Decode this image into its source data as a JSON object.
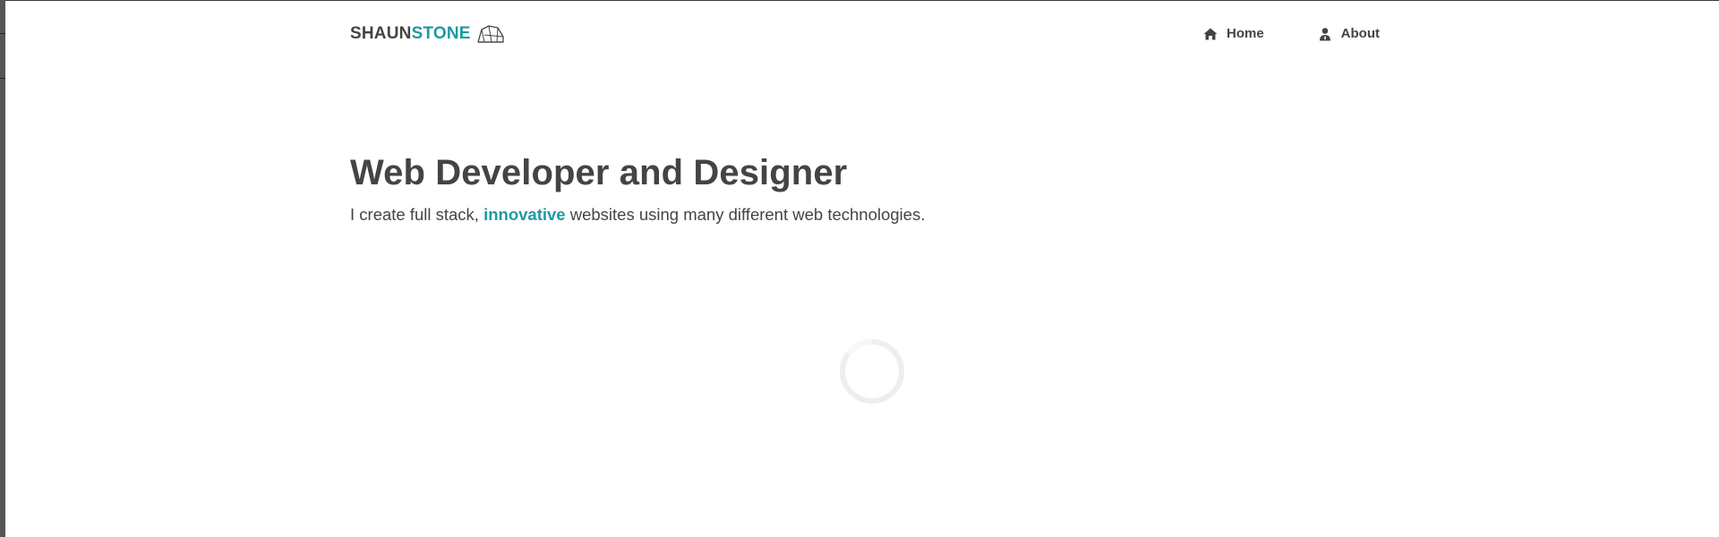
{
  "brand": {
    "part1": "SHAUN",
    "part2": "STONE",
    "logo_icon": "house-outline-icon"
  },
  "nav": {
    "items": [
      {
        "label": "Home",
        "icon": "home-icon"
      },
      {
        "label": "About",
        "icon": "user-icon"
      }
    ]
  },
  "hero": {
    "title": "Web Developer and Designer",
    "subtitle_before": "I create full stack, ",
    "subtitle_highlight": "innovative",
    "subtitle_after": " websites using many different web technologies."
  },
  "loader": {
    "icon": "loading-spinner-icon"
  },
  "colors": {
    "accent": "#1e9aa0",
    "text": "#444444",
    "background": "#ffffff",
    "spinner_track": "#eeeeee"
  }
}
